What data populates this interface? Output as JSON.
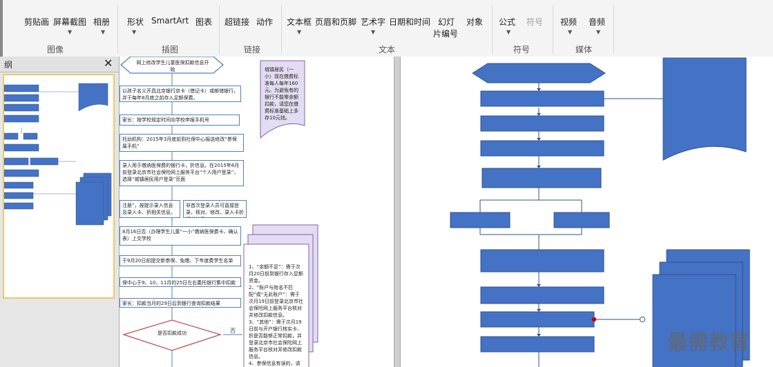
{
  "ribbon": {
    "items": [
      {
        "label": "剪贴画"
      },
      {
        "label": "屏幕截图"
      },
      {
        "label": "相册"
      },
      {
        "label": "形状"
      },
      {
        "label": "SmartArt"
      },
      {
        "label": "图表"
      },
      {
        "label": "超链接"
      },
      {
        "label": "动作"
      },
      {
        "label": "文本框"
      },
      {
        "label": "页眉和页脚"
      },
      {
        "label": "艺术字"
      },
      {
        "label": "日期和时间"
      },
      {
        "label": "幻灯"
      },
      {
        "label": "片编号"
      },
      {
        "label": "对象"
      },
      {
        "label": "公式"
      },
      {
        "label": "符号"
      },
      {
        "label": "视频"
      },
      {
        "label": "音频"
      }
    ],
    "groups": [
      {
        "label": "图像"
      },
      {
        "label": "插图"
      },
      {
        "label": "链接"
      },
      {
        "label": "文本"
      },
      {
        "label": "符号"
      },
      {
        "label": "媒体"
      }
    ]
  },
  "outline_panel": {
    "title": "纲",
    "close": "✕"
  },
  "flowchart": {
    "start": "网上修改学生儿童医保扣款信息开始",
    "steps": [
      "以孩子名义开具北京银行京卡（借记卡）或邮储银行，并于每年8月底之前存入足额保费。",
      "家长：按学校规定时间向学校申报手机号",
      "托幼机构：2015年3月底前到社保中心报送修改“参保属手机”",
      "录入用于缴纳医保费的银行卡，折信息。在2015年6月前登录北京市社会保险网上服务平台“个人用户登录”，选择“城镇居民用户登录”页面",
      "注册”，按提示录入信息及录入卡、折相关信息。",
      "非首次登录人员可直接登录，核对、修改、录入卡折相关信息。",
      "8月16日否（办理学生儿童“一小”缴纳医保费卡、确认表）上交学校",
      "于9月20日前提交新参保、免缴、下年度费学生名单",
      "保中心于9、10、11月的25日左右委托银行集中扣款",
      "家长：扣款当月的29日后到银行查询扣款结果"
    ],
    "decision": "是否扣款成功",
    "no_label": "否",
    "note1": "城镇居民（一小）现在缴费标准每人每年160元。为避免有的银行不能零余额扣款，请您在缴费标准基础上多存10元钱。",
    "note2": "1、“余额不足”：需于次月20日前到银行存入足额资金。\n2、“账户与姓名不匹配”或“无此账户”：需于次月19日前登录北京市社会保险网上服务平台核对并修改扣款信息。\n3、“其他”：需于次月19日前与开户银行核实卡、折是否能够正常扣款，并登录北京市社会保险网上服务平台核对并修改扣款信息。\n4、参保信息有误的，请"
  },
  "watermark": "最需教育",
  "colors": {
    "accent": "#4472c4",
    "stroke": "#2f528f",
    "note_fill": "#e4dcf2",
    "highlight_border": "#f2c760"
  }
}
